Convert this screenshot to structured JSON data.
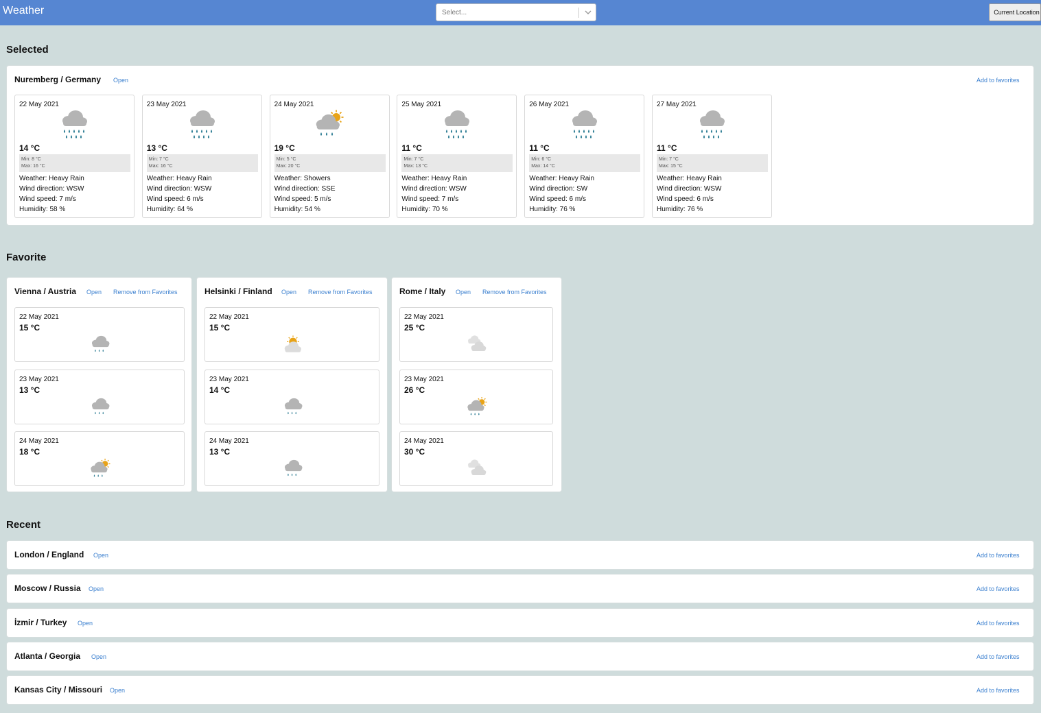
{
  "header": {
    "title": "Weather",
    "search_placeholder": "Select...",
    "current_location_label": "Current Location"
  },
  "sections": {
    "selected": "Selected",
    "favorite": "Favorite",
    "recent": "Recent"
  },
  "links": {
    "open": "Open",
    "add_favorites": "Add to favorites",
    "remove_favorites": "Remove from Favorites"
  },
  "selected": {
    "city": "Nuremberg / Germany",
    "days": [
      {
        "date": "22 May 2021",
        "temp": "14 °C",
        "min": "Min: 8 °C",
        "max": "Max: 16 °C",
        "weather": "Weather: Heavy Rain",
        "wind_dir": "Wind direction: WSW",
        "wind_speed": "Wind speed: 7 m/s",
        "humidity": "Humidity: 58 %",
        "icon": "heavy-rain-icon"
      },
      {
        "date": "23 May 2021",
        "temp": "13 °C",
        "min": "Min: 7 °C",
        "max": "Max: 16 °C",
        "weather": "Weather: Heavy Rain",
        "wind_dir": "Wind direction: WSW",
        "wind_speed": "Wind speed: 6 m/s",
        "humidity": "Humidity: 64 %",
        "icon": "heavy-rain-icon"
      },
      {
        "date": "24 May 2021",
        "temp": "19 °C",
        "min": "Min: 5 °C",
        "max": "Max: 20 °C",
        "weather": "Weather: Showers",
        "wind_dir": "Wind direction: SSE",
        "wind_speed": "Wind speed: 5 m/s",
        "humidity": "Humidity: 54 %",
        "icon": "showers-icon"
      },
      {
        "date": "25 May 2021",
        "temp": "11 °C",
        "min": "Min: 7 °C",
        "max": "Max: 13 °C",
        "weather": "Weather: Heavy Rain",
        "wind_dir": "Wind direction: WSW",
        "wind_speed": "Wind speed: 7 m/s",
        "humidity": "Humidity: 70 %",
        "icon": "heavy-rain-icon"
      },
      {
        "date": "26 May 2021",
        "temp": "11 °C",
        "min": "Min: 6 °C",
        "max": "Max: 14 °C",
        "weather": "Weather: Heavy Rain",
        "wind_dir": "Wind direction: SW",
        "wind_speed": "Wind speed: 6 m/s",
        "humidity": "Humidity: 76 %",
        "icon": "heavy-rain-icon"
      },
      {
        "date": "27 May 2021",
        "temp": "11 °C",
        "min": "Min: 7 °C",
        "max": "Max: 15 °C",
        "weather": "Weather: Heavy Rain",
        "wind_dir": "Wind direction: WSW",
        "wind_speed": "Wind speed: 6 m/s",
        "humidity": "Humidity: 76 %",
        "icon": "heavy-rain-icon"
      }
    ]
  },
  "favorites": [
    {
      "city": "Vienna / Austria",
      "days": [
        {
          "date": "22 May 2021",
          "temp": "15 °C",
          "icon": "light-rain-icon"
        },
        {
          "date": "23 May 2021",
          "temp": "13 °C",
          "icon": "light-rain-icon"
        },
        {
          "date": "24 May 2021",
          "temp": "18 °C",
          "icon": "showers-icon"
        }
      ]
    },
    {
      "city": "Helsinki / Finland",
      "days": [
        {
          "date": "22 May 2021",
          "temp": "15 °C",
          "icon": "partly-cloudy-icon"
        },
        {
          "date": "23 May 2021",
          "temp": "14 °C",
          "icon": "light-rain-icon"
        },
        {
          "date": "24 May 2021",
          "temp": "13 °C",
          "icon": "light-rain-icon"
        }
      ]
    },
    {
      "city": "Rome / Italy",
      "days": [
        {
          "date": "22 May 2021",
          "temp": "25 °C",
          "icon": "light-cloud-icon"
        },
        {
          "date": "23 May 2021",
          "temp": "26 °C",
          "icon": "showers-icon"
        },
        {
          "date": "24 May 2021",
          "temp": "30 °C",
          "icon": "light-cloud-icon"
        }
      ]
    }
  ],
  "recent": [
    {
      "city": "London / England"
    },
    {
      "city": "Moscow / Russia"
    },
    {
      "city": "İzmir / Turkey"
    },
    {
      "city": "Atlanta / Georgia"
    },
    {
      "city": "Kansas City / Missouri"
    }
  ],
  "colors": {
    "header": "#5686d2",
    "background": "#cfdcdc",
    "link": "#3a7fcf",
    "rain": "#2e7d94",
    "sun": "#e8a317"
  }
}
